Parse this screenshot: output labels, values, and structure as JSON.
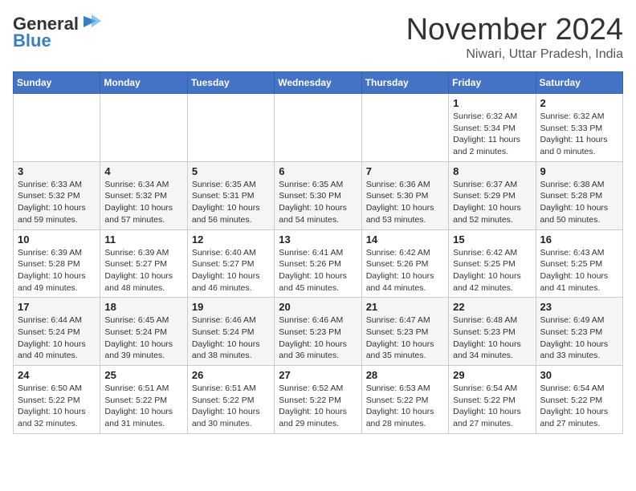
{
  "header": {
    "logo_general": "General",
    "logo_blue": "Blue",
    "month_title": "November 2024",
    "subtitle": "Niwari, Uttar Pradesh, India"
  },
  "weekdays": [
    "Sunday",
    "Monday",
    "Tuesday",
    "Wednesday",
    "Thursday",
    "Friday",
    "Saturday"
  ],
  "weeks": [
    [
      {
        "day": "",
        "sunrise": "",
        "sunset": "",
        "daylight": ""
      },
      {
        "day": "",
        "sunrise": "",
        "sunset": "",
        "daylight": ""
      },
      {
        "day": "",
        "sunrise": "",
        "sunset": "",
        "daylight": ""
      },
      {
        "day": "",
        "sunrise": "",
        "sunset": "",
        "daylight": ""
      },
      {
        "day": "",
        "sunrise": "",
        "sunset": "",
        "daylight": ""
      },
      {
        "day": "1",
        "sunrise": "Sunrise: 6:32 AM",
        "sunset": "Sunset: 5:34 PM",
        "daylight": "Daylight: 11 hours and 2 minutes."
      },
      {
        "day": "2",
        "sunrise": "Sunrise: 6:32 AM",
        "sunset": "Sunset: 5:33 PM",
        "daylight": "Daylight: 11 hours and 0 minutes."
      }
    ],
    [
      {
        "day": "3",
        "sunrise": "Sunrise: 6:33 AM",
        "sunset": "Sunset: 5:32 PM",
        "daylight": "Daylight: 10 hours and 59 minutes."
      },
      {
        "day": "4",
        "sunrise": "Sunrise: 6:34 AM",
        "sunset": "Sunset: 5:32 PM",
        "daylight": "Daylight: 10 hours and 57 minutes."
      },
      {
        "day": "5",
        "sunrise": "Sunrise: 6:35 AM",
        "sunset": "Sunset: 5:31 PM",
        "daylight": "Daylight: 10 hours and 56 minutes."
      },
      {
        "day": "6",
        "sunrise": "Sunrise: 6:35 AM",
        "sunset": "Sunset: 5:30 PM",
        "daylight": "Daylight: 10 hours and 54 minutes."
      },
      {
        "day": "7",
        "sunrise": "Sunrise: 6:36 AM",
        "sunset": "Sunset: 5:30 PM",
        "daylight": "Daylight: 10 hours and 53 minutes."
      },
      {
        "day": "8",
        "sunrise": "Sunrise: 6:37 AM",
        "sunset": "Sunset: 5:29 PM",
        "daylight": "Daylight: 10 hours and 52 minutes."
      },
      {
        "day": "9",
        "sunrise": "Sunrise: 6:38 AM",
        "sunset": "Sunset: 5:28 PM",
        "daylight": "Daylight: 10 hours and 50 minutes."
      }
    ],
    [
      {
        "day": "10",
        "sunrise": "Sunrise: 6:39 AM",
        "sunset": "Sunset: 5:28 PM",
        "daylight": "Daylight: 10 hours and 49 minutes."
      },
      {
        "day": "11",
        "sunrise": "Sunrise: 6:39 AM",
        "sunset": "Sunset: 5:27 PM",
        "daylight": "Daylight: 10 hours and 48 minutes."
      },
      {
        "day": "12",
        "sunrise": "Sunrise: 6:40 AM",
        "sunset": "Sunset: 5:27 PM",
        "daylight": "Daylight: 10 hours and 46 minutes."
      },
      {
        "day": "13",
        "sunrise": "Sunrise: 6:41 AM",
        "sunset": "Sunset: 5:26 PM",
        "daylight": "Daylight: 10 hours and 45 minutes."
      },
      {
        "day": "14",
        "sunrise": "Sunrise: 6:42 AM",
        "sunset": "Sunset: 5:26 PM",
        "daylight": "Daylight: 10 hours and 44 minutes."
      },
      {
        "day": "15",
        "sunrise": "Sunrise: 6:42 AM",
        "sunset": "Sunset: 5:25 PM",
        "daylight": "Daylight: 10 hours and 42 minutes."
      },
      {
        "day": "16",
        "sunrise": "Sunrise: 6:43 AM",
        "sunset": "Sunset: 5:25 PM",
        "daylight": "Daylight: 10 hours and 41 minutes."
      }
    ],
    [
      {
        "day": "17",
        "sunrise": "Sunrise: 6:44 AM",
        "sunset": "Sunset: 5:24 PM",
        "daylight": "Daylight: 10 hours and 40 minutes."
      },
      {
        "day": "18",
        "sunrise": "Sunrise: 6:45 AM",
        "sunset": "Sunset: 5:24 PM",
        "daylight": "Daylight: 10 hours and 39 minutes."
      },
      {
        "day": "19",
        "sunrise": "Sunrise: 6:46 AM",
        "sunset": "Sunset: 5:24 PM",
        "daylight": "Daylight: 10 hours and 38 minutes."
      },
      {
        "day": "20",
        "sunrise": "Sunrise: 6:46 AM",
        "sunset": "Sunset: 5:23 PM",
        "daylight": "Daylight: 10 hours and 36 minutes."
      },
      {
        "day": "21",
        "sunrise": "Sunrise: 6:47 AM",
        "sunset": "Sunset: 5:23 PM",
        "daylight": "Daylight: 10 hours and 35 minutes."
      },
      {
        "day": "22",
        "sunrise": "Sunrise: 6:48 AM",
        "sunset": "Sunset: 5:23 PM",
        "daylight": "Daylight: 10 hours and 34 minutes."
      },
      {
        "day": "23",
        "sunrise": "Sunrise: 6:49 AM",
        "sunset": "Sunset: 5:23 PM",
        "daylight": "Daylight: 10 hours and 33 minutes."
      }
    ],
    [
      {
        "day": "24",
        "sunrise": "Sunrise: 6:50 AM",
        "sunset": "Sunset: 5:22 PM",
        "daylight": "Daylight: 10 hours and 32 minutes."
      },
      {
        "day": "25",
        "sunrise": "Sunrise: 6:51 AM",
        "sunset": "Sunset: 5:22 PM",
        "daylight": "Daylight: 10 hours and 31 minutes."
      },
      {
        "day": "26",
        "sunrise": "Sunrise: 6:51 AM",
        "sunset": "Sunset: 5:22 PM",
        "daylight": "Daylight: 10 hours and 30 minutes."
      },
      {
        "day": "27",
        "sunrise": "Sunrise: 6:52 AM",
        "sunset": "Sunset: 5:22 PM",
        "daylight": "Daylight: 10 hours and 29 minutes."
      },
      {
        "day": "28",
        "sunrise": "Sunrise: 6:53 AM",
        "sunset": "Sunset: 5:22 PM",
        "daylight": "Daylight: 10 hours and 28 minutes."
      },
      {
        "day": "29",
        "sunrise": "Sunrise: 6:54 AM",
        "sunset": "Sunset: 5:22 PM",
        "daylight": "Daylight: 10 hours and 27 minutes."
      },
      {
        "day": "30",
        "sunrise": "Sunrise: 6:54 AM",
        "sunset": "Sunset: 5:22 PM",
        "daylight": "Daylight: 10 hours and 27 minutes."
      }
    ]
  ]
}
